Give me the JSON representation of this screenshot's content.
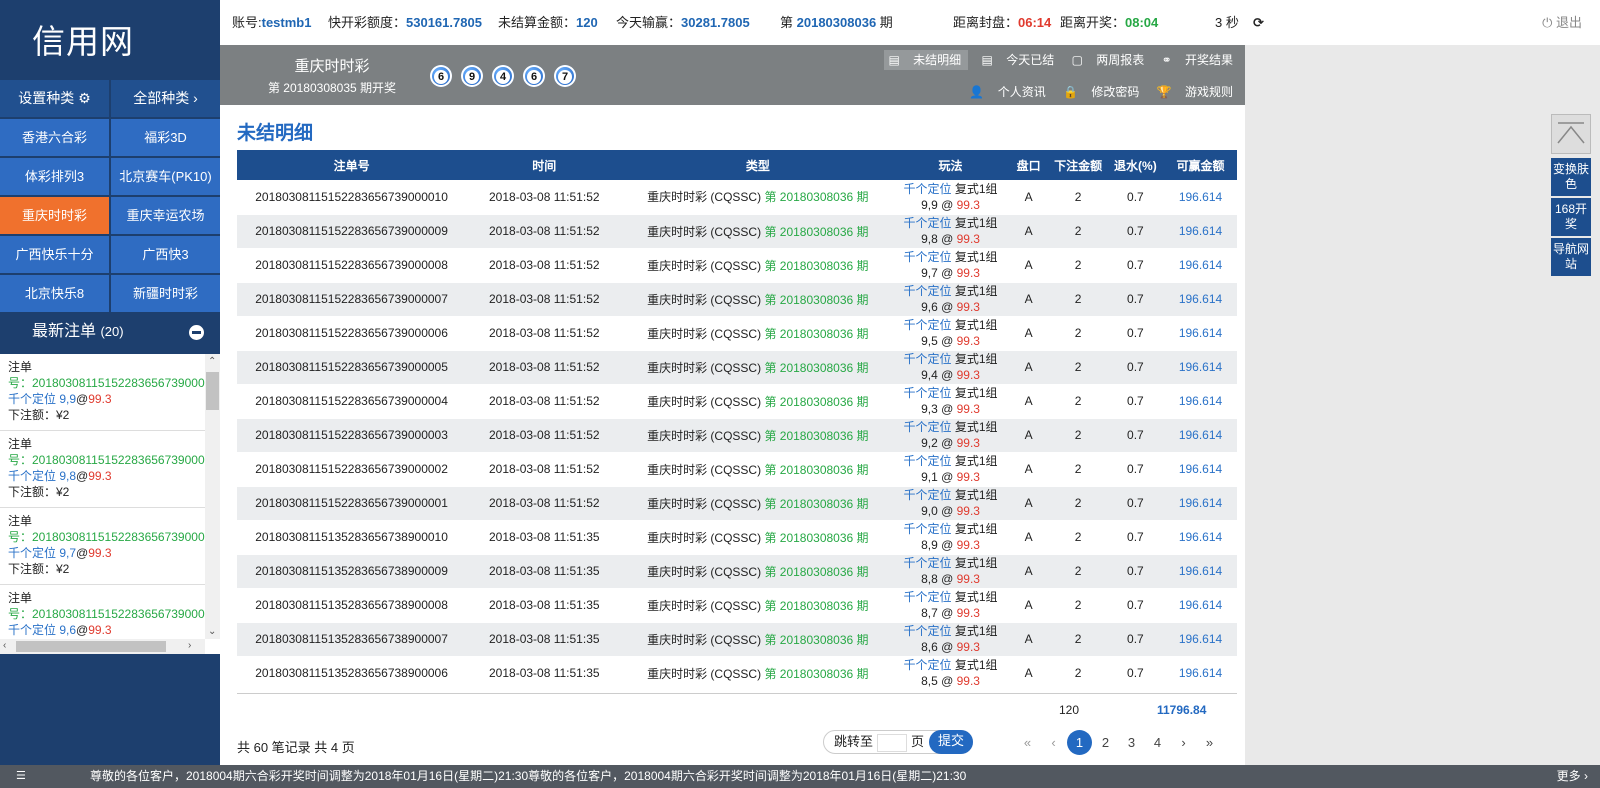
{
  "sidebar": {
    "logo": "信用网",
    "head_buttons": [
      "设置种类 ⚙",
      "全部种类 ›"
    ],
    "games": [
      "香港六合彩",
      "福彩3D",
      "体彩排列3",
      "北京赛车(PK10)",
      "重庆时时彩",
      "重庆幸运农场",
      "广西快乐十分",
      "广西快3",
      "北京快乐8",
      "新疆时时彩"
    ],
    "active_game": "重庆时时彩",
    "recent_title": "最新注单",
    "recent_count": "(20)",
    "recent": [
      {
        "label": "注单",
        "no": "号：201803081151522836567390000",
        "play": "千个定位 9,9",
        "rate": "99.3",
        "amount": "下注额：¥2"
      },
      {
        "label": "注单",
        "no": "号：201803081151522836567390000",
        "play": "千个定位 9,8",
        "rate": "99.3",
        "amount": "下注额：¥2"
      },
      {
        "label": "注单",
        "no": "号：201803081151522836567390000",
        "play": "千个定位 9,7",
        "rate": "99.3",
        "amount": "下注额：¥2"
      },
      {
        "label": "注单",
        "no": "号：201803081151522836567390000",
        "play": "千个定位 9,6",
        "rate": "99.3",
        "amount": ""
      }
    ]
  },
  "topbar": {
    "account_label": "账号:",
    "account": "testmb1",
    "quota_label": "快开彩额度：",
    "quota": "530161.7805",
    "unsettled_label": "未结算金额：",
    "unsettled": "120",
    "today_label": "今天输赢：",
    "today": "30281.7805",
    "period_prefix": "第",
    "period": "20180308036",
    "period_suffix": "期",
    "close_label": "距离封盘：",
    "close": "06:14",
    "open_label": "距离开奖：",
    "open": "08:04",
    "refresh": "3 秒",
    "logout": "⏻ 退出"
  },
  "lottery": {
    "name": "重庆时时彩",
    "period": "第 20180308035 期开奖",
    "balls": [
      "6",
      "9",
      "4",
      "6",
      "7"
    ]
  },
  "links": [
    "未结明细",
    "今天已结",
    "两周报表",
    "开奖结果",
    "个人资讯",
    "修改密码",
    "游戏规则"
  ],
  "content_title": "未结明细",
  "table": {
    "headers": [
      "注单号",
      "时间",
      "类型",
      "玩法",
      "盘口",
      "下注金额",
      "退水(%)",
      "可赢金额"
    ],
    "type_name": "重庆时时彩 (CQSSC)",
    "type_period": "第 20180308036 期",
    "play_name": "千个定位",
    "play_kind": "复式1组",
    "rate": "99.3",
    "handicap": "A",
    "amount": "2",
    "rebate": "0.7",
    "win": "196.614",
    "rows": [
      {
        "id": "201803081151522836567390000​10",
        "time": "2018-03-08 11:51:52",
        "nums": "9,9"
      },
      {
        "id": "20180308115152283656739000009",
        "time": "2018-03-08 11:51:52",
        "nums": "9,8"
      },
      {
        "id": "20180308115152283656739000008",
        "time": "2018-03-08 11:51:52",
        "nums": "9,7"
      },
      {
        "id": "20180308115152283656739000007",
        "time": "2018-03-08 11:51:52",
        "nums": "9,6"
      },
      {
        "id": "20180308115152283656739000006",
        "time": "2018-03-08 11:51:52",
        "nums": "9,5"
      },
      {
        "id": "20180308115152283656739000005",
        "time": "2018-03-08 11:51:52",
        "nums": "9,4"
      },
      {
        "id": "20180308115152283656739000004",
        "time": "2018-03-08 11:51:52",
        "nums": "9,3"
      },
      {
        "id": "20180308115152283656739000003",
        "time": "2018-03-08 11:51:52",
        "nums": "9,2"
      },
      {
        "id": "20180308115152283656739000002",
        "time": "2018-03-08 11:51:52",
        "nums": "9,1"
      },
      {
        "id": "20180308115152283656739000001",
        "time": "2018-03-08 11:51:52",
        "nums": "9,0"
      },
      {
        "id": "20180308115135283656738900010",
        "time": "2018-03-08 11:51:35",
        "nums": "8,9"
      },
      {
        "id": "20180308115135283656738900009",
        "time": "2018-03-08 11:51:35",
        "nums": "8,8"
      },
      {
        "id": "20180308115135283656738900008",
        "time": "2018-03-08 11:51:35",
        "nums": "8,7"
      },
      {
        "id": "20180308115135283656738900007",
        "time": "2018-03-08 11:51:35",
        "nums": "8,6"
      },
      {
        "id": "20180308115135283656738900006",
        "time": "2018-03-08 11:51:35",
        "nums": "8,5"
      }
    ],
    "total_amount": "120",
    "total_win": "11796.84"
  },
  "pager": {
    "records": "共 60 笔记录  共 4 页",
    "jump_label": "跳转至",
    "page_label": "页",
    "submit": "提交",
    "first": "«",
    "prev": "‹",
    "pages": [
      "1",
      "2",
      "3",
      "4"
    ],
    "next": "›",
    "last": "»"
  },
  "float": {
    "skin": "变换肤色",
    "kaijiang": "168开奖",
    "nav": "导航网站"
  },
  "footer": {
    "rss": "☰",
    "message": "尊敬的各位客户，2018004期六合彩开奖时间调整为2018年01月16日(星期二)21:30尊敬的各位客户，2018004期六合彩开奖时间调整为2018年01月16日(星期二)21:30",
    "more": "更多 ›"
  }
}
